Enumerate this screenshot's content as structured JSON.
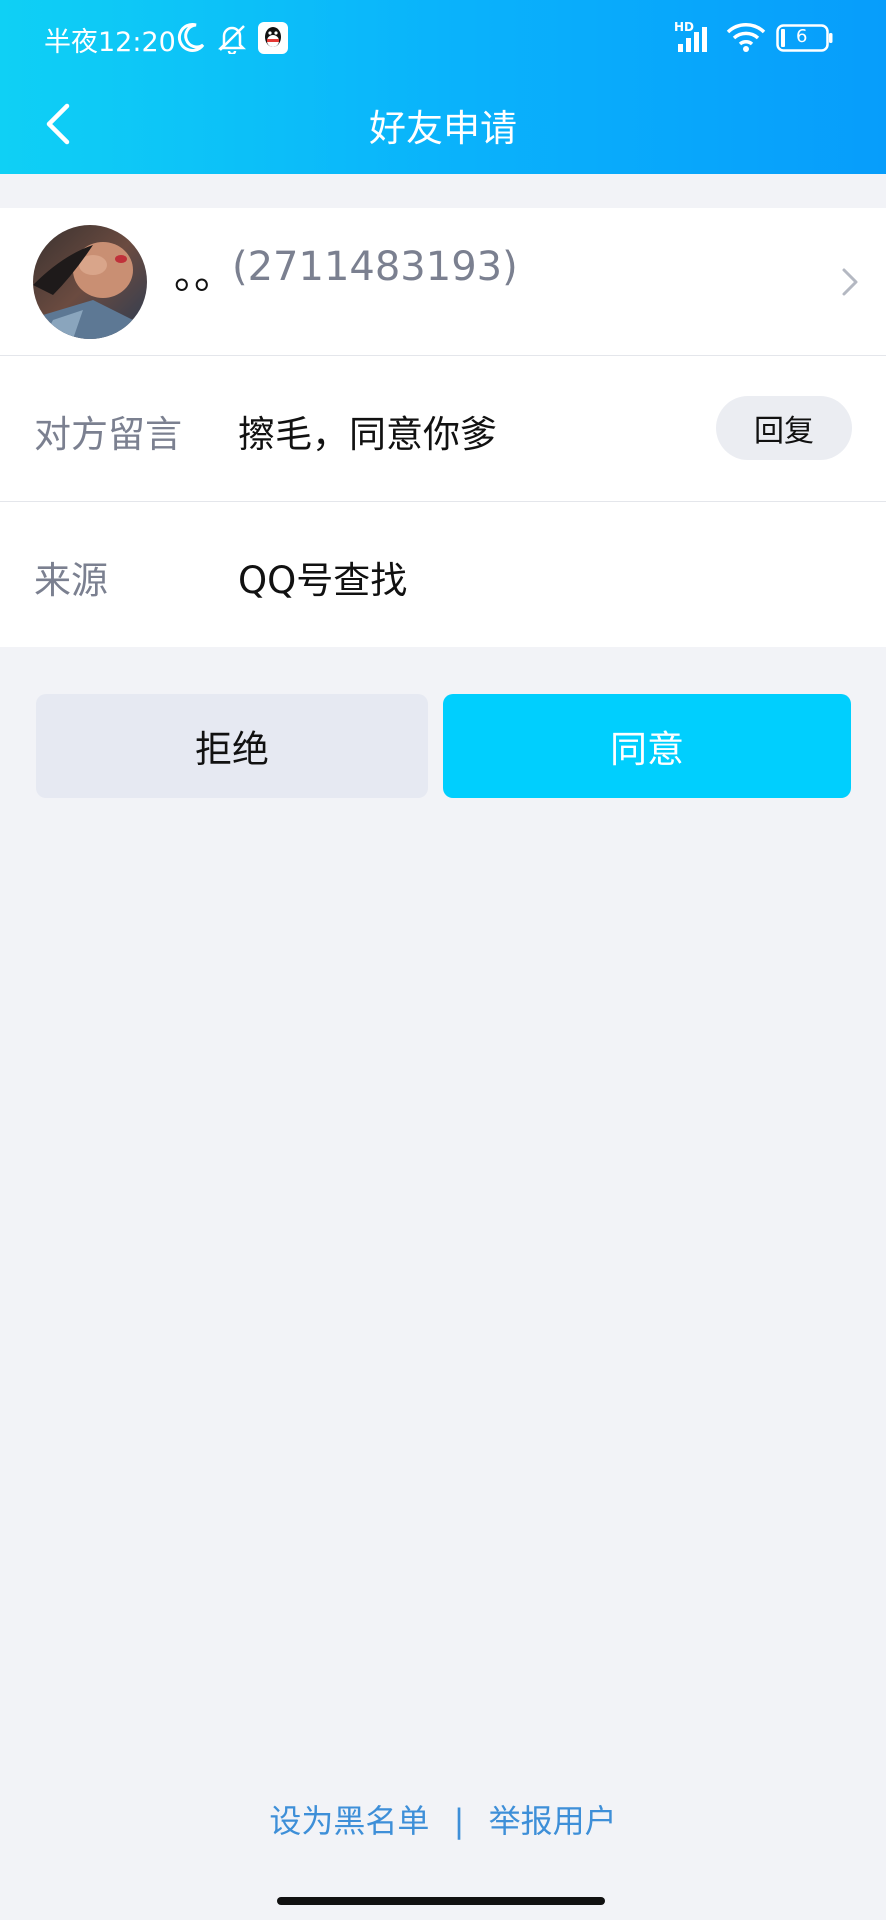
{
  "status_bar": {
    "time": "半夜12:20",
    "battery": "6",
    "hd_label": "HD"
  },
  "nav": {
    "title": "好友申请"
  },
  "requester": {
    "name": "。。",
    "qq_id": "(2711483193)"
  },
  "message": {
    "label": "对方留言",
    "value": "擦毛，同意你爹",
    "reply_label": "回复"
  },
  "source": {
    "label": "来源",
    "value": "QQ号查找"
  },
  "actions": {
    "reject_label": "拒绝",
    "accept_label": "同意"
  },
  "footer": {
    "blacklist_label": "设为黑名单",
    "separator": "|",
    "report_label": "举报用户"
  },
  "colors": {
    "accent": "#00cffe",
    "link": "#3e8fd8",
    "header_start": "#0fd0f5",
    "header_end": "#079dfb"
  }
}
